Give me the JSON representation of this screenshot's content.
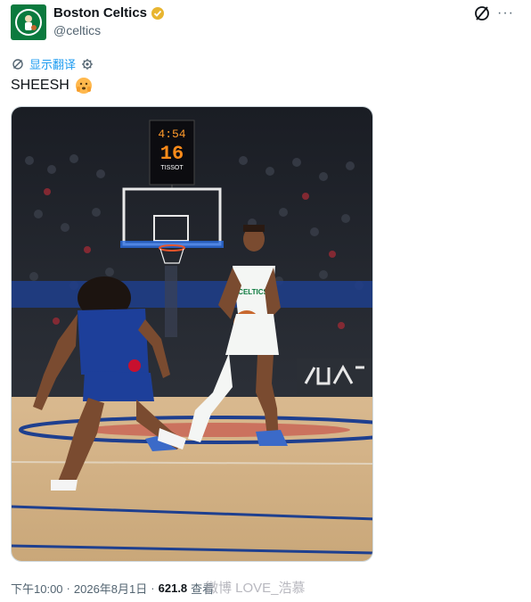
{
  "author": {
    "display_name": "Boston Celtics",
    "handle": "@celtics"
  },
  "actions": {
    "more": "···"
  },
  "translate": {
    "label": "显示翻译"
  },
  "tweet": {
    "text": "SHEESH"
  },
  "photo": {
    "shot_clock_time": "4:54",
    "shot_clock_seconds": "16",
    "shot_clock_sponsor": "TISSOT",
    "jersey_text": "CELTICS"
  },
  "meta": {
    "time": "下午10:00",
    "separator_1": "·",
    "date": "2026年8月1日",
    "separator_2": "·",
    "views_count": "621.8",
    "views_label": "查看"
  },
  "watermark": {
    "text": "微博 LOVE_浩慕"
  },
  "colors": {
    "brand_green": "#0b7a3e",
    "verified_gold": "#e8b530",
    "link_blue": "#1d9bf0"
  }
}
